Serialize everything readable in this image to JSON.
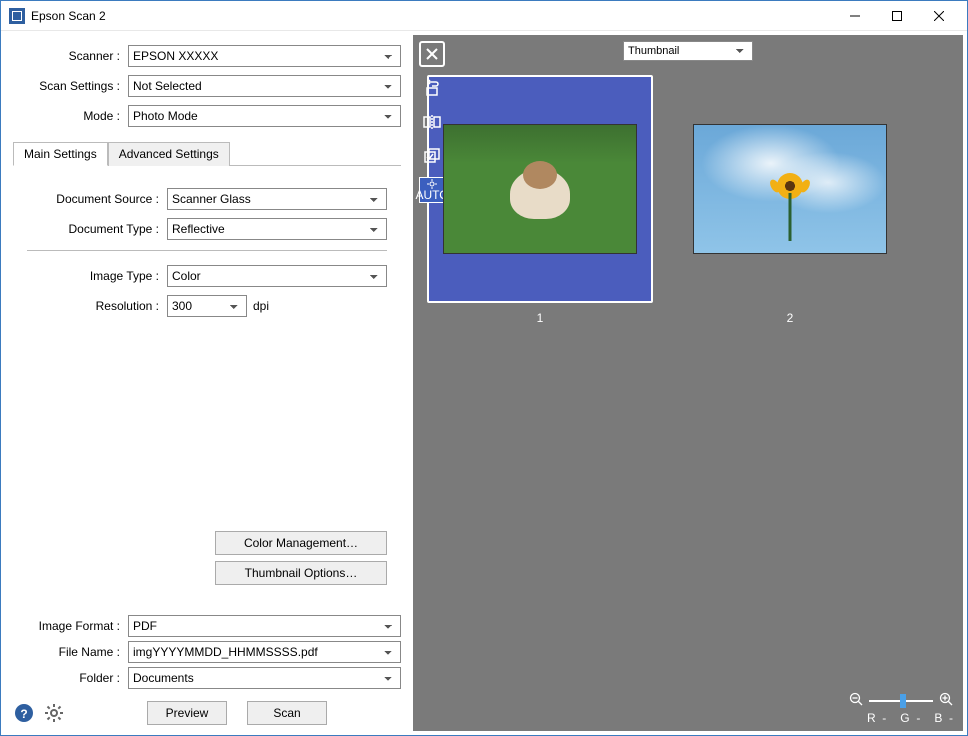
{
  "window": {
    "title": "Epson Scan 2"
  },
  "top": {
    "scanner_label": "Scanner :",
    "scanner": "EPSON XXXXX",
    "scan_settings_label": "Scan Settings :",
    "scan_settings": "Not Selected",
    "mode_label": "Mode :",
    "mode": "Photo Mode"
  },
  "tabs": {
    "main": "Main Settings",
    "advanced": "Advanced Settings"
  },
  "settings": {
    "doc_source_label": "Document Source :",
    "doc_source": "Scanner Glass",
    "doc_type_label": "Document Type :",
    "doc_type": "Reflective",
    "image_type_label": "Image Type :",
    "image_type": "Color",
    "resolution_label": "Resolution :",
    "resolution": "300",
    "resolution_unit": "dpi",
    "color_mgmt": "Color Management…",
    "thumb_opts": "Thumbnail Options…"
  },
  "output": {
    "image_format_label": "Image Format :",
    "image_format": "PDF",
    "file_name_label": "File Name :",
    "file_name": "imgYYYYMMDD_HHMMSSSS.pdf",
    "folder_label": "Folder :",
    "folder": "Documents"
  },
  "footer": {
    "preview": "Preview",
    "scan": "Scan"
  },
  "preview": {
    "view_mode": "Thumbnail",
    "auto_label": "AUTO",
    "thumbs": [
      "1",
      "2"
    ],
    "rgb": {
      "r": "R",
      "rdash": "-",
      "g": "G",
      "gdash": "-",
      "b": "B",
      "bdash": "-"
    }
  }
}
